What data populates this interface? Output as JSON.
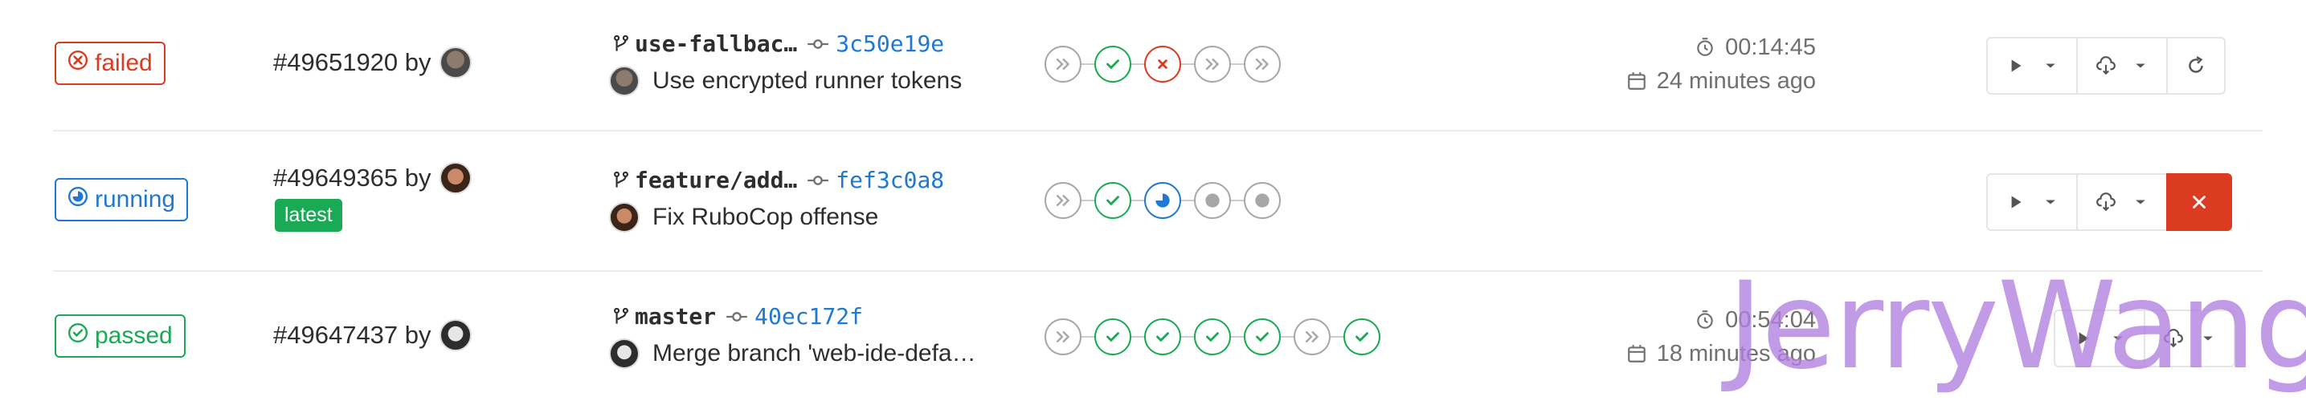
{
  "pipelines": [
    {
      "status": "failed",
      "id_text": "#49651920 by",
      "branch": "use-fallbac…",
      "sha": "3c50e19e",
      "commit_message": "Use encrypted runner tokens",
      "stages": [
        "skipped",
        "success",
        "failed",
        "skipped",
        "skipped"
      ],
      "duration": "00:14:45",
      "finished": "24 minutes ago",
      "actions": [
        "play",
        "download",
        "retry"
      ]
    },
    {
      "status": "running",
      "id_text": "#49649365 by",
      "tag": "latest",
      "branch": "feature/add…",
      "sha": "fef3c0a8",
      "commit_message": "Fix RuboCop offense",
      "stages": [
        "skipped",
        "success",
        "running",
        "created",
        "created"
      ],
      "actions": [
        "play",
        "download",
        "cancel"
      ]
    },
    {
      "status": "passed",
      "id_text": "#49647437 by",
      "branch": "master",
      "sha": "40ec172f",
      "commit_message": "Merge branch 'web-ide-defa…",
      "stages": [
        "skipped",
        "success",
        "success",
        "success",
        "success",
        "skipped",
        "success"
      ],
      "duration": "00:54:04",
      "finished": "18 minutes ago",
      "actions": [
        "play",
        "download"
      ]
    }
  ],
  "watermark": "JerryWang",
  "colors": {
    "failed": "#db3b21",
    "running": "#1f78d1",
    "passed": "#1aaa55",
    "link": "#1f78d1"
  },
  "icons": {
    "failed": "close-circle-icon",
    "running": "half-circle-icon",
    "passed": "check-circle-icon",
    "branch": "branch-icon",
    "commit": "commit-icon",
    "timer": "timer-icon",
    "calendar": "calendar-icon",
    "play": "play-icon",
    "download": "download-icon",
    "retry": "retry-icon",
    "cancel": "close-icon"
  }
}
